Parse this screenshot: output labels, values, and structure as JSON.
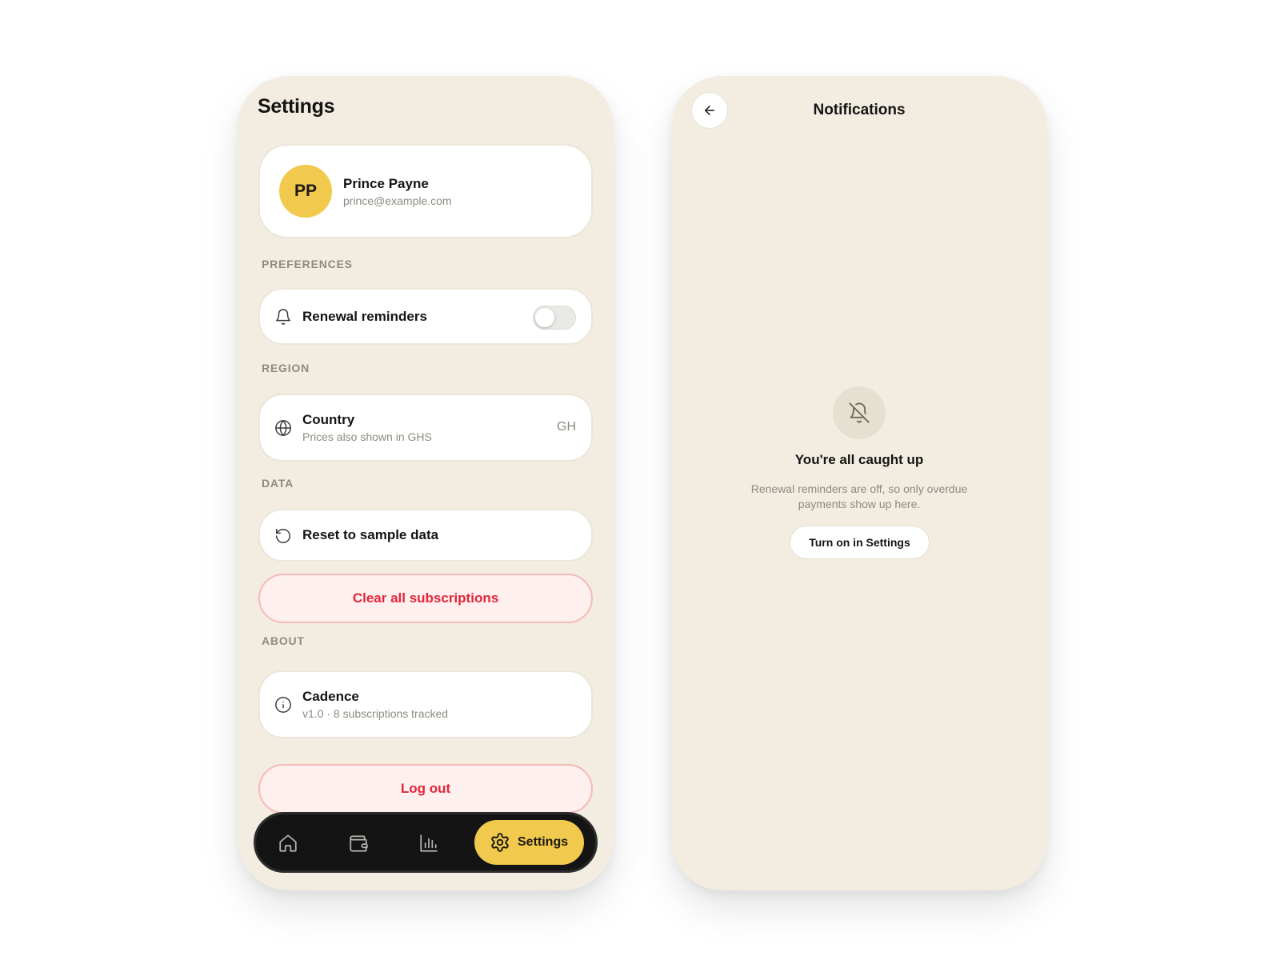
{
  "settings_screen": {
    "title": "Settings",
    "profile": {
      "initials": "PP",
      "name": "Prince Payne",
      "email": "prince@example.com",
      "avatar_color": "#f0c94d"
    },
    "preferences": {
      "section_label": "PREFERENCES",
      "reminders": {
        "icon": "bell-icon",
        "label": "Renewal reminders",
        "enabled": false
      }
    },
    "region": {
      "section_label": "REGION",
      "country": {
        "icon": "globe-icon",
        "label": "Country",
        "subtitle": "Prices also shown in GHS",
        "value": "GH"
      }
    },
    "data": {
      "section_label": "DATA",
      "reset": {
        "icon": "reset-icon",
        "label": "Reset to sample data"
      },
      "clear_label": "Clear all subscriptions"
    },
    "about": {
      "section_label": "ABOUT",
      "app": {
        "icon": "info-icon",
        "label": "Cadence",
        "subtitle": "v1.0 · 8 subscriptions tracked"
      }
    },
    "logout_label": "Log out",
    "tab_bar": {
      "tabs": [
        {
          "icon": "home-icon",
          "active": false
        },
        {
          "icon": "wallet-icon",
          "active": false
        },
        {
          "icon": "bar-chart-icon",
          "active": false
        },
        {
          "icon": "gear-icon",
          "label": "Settings",
          "active": true
        }
      ]
    }
  },
  "notifications_screen": {
    "title": "Notifications",
    "back_icon": "arrow-left-icon",
    "empty_state": {
      "icon": "bell-off-icon",
      "title": "You're all caught up",
      "body": "Renewal reminders are off, so only overdue payments show up here.",
      "button_label": "Turn on in Settings"
    }
  },
  "colors": {
    "screen_bg": "#f2ede0",
    "accent_yellow": "#f0c94d",
    "danger_red": "#e5253a",
    "danger_bg": "#fdf0ee",
    "tab_bar_bg": "#141414"
  }
}
